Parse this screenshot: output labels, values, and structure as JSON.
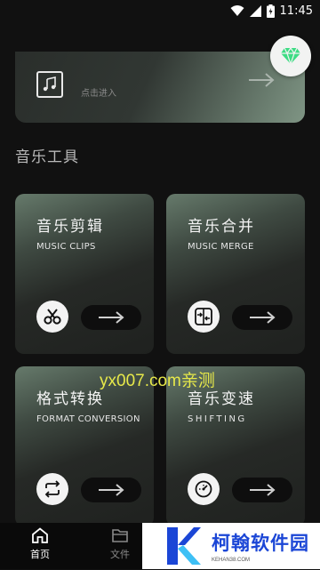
{
  "status_bar": {
    "time": "11:45"
  },
  "top_card": {
    "enter_text": "点击进入"
  },
  "section": {
    "title": "音乐工具"
  },
  "tools": [
    {
      "title": "音乐剪辑",
      "subtitle": "MUSIC CLIPS",
      "icon": "scissors-icon"
    },
    {
      "title": "音乐合并",
      "subtitle": "MUSIC MERGE",
      "icon": "merge-icon"
    },
    {
      "title": "格式转换",
      "subtitle": "FORMAT CONVERSION",
      "icon": "convert-icon"
    },
    {
      "title": "音乐变速",
      "subtitle": "SHIFTING",
      "icon": "speedometer-icon"
    }
  ],
  "watermark": "yx007.com亲测",
  "bottom_nav": {
    "items": [
      {
        "label": "首页",
        "icon": "home-icon"
      },
      {
        "label": "文件",
        "icon": "folder-icon"
      }
    ]
  },
  "brand": {
    "name": "柯翰软件园",
    "url": "KEHAN38.COM"
  },
  "colors": {
    "accent": "#3ddc84",
    "background": "#111111",
    "watermark": "#e7e94a",
    "brand": "#1b46d6"
  }
}
